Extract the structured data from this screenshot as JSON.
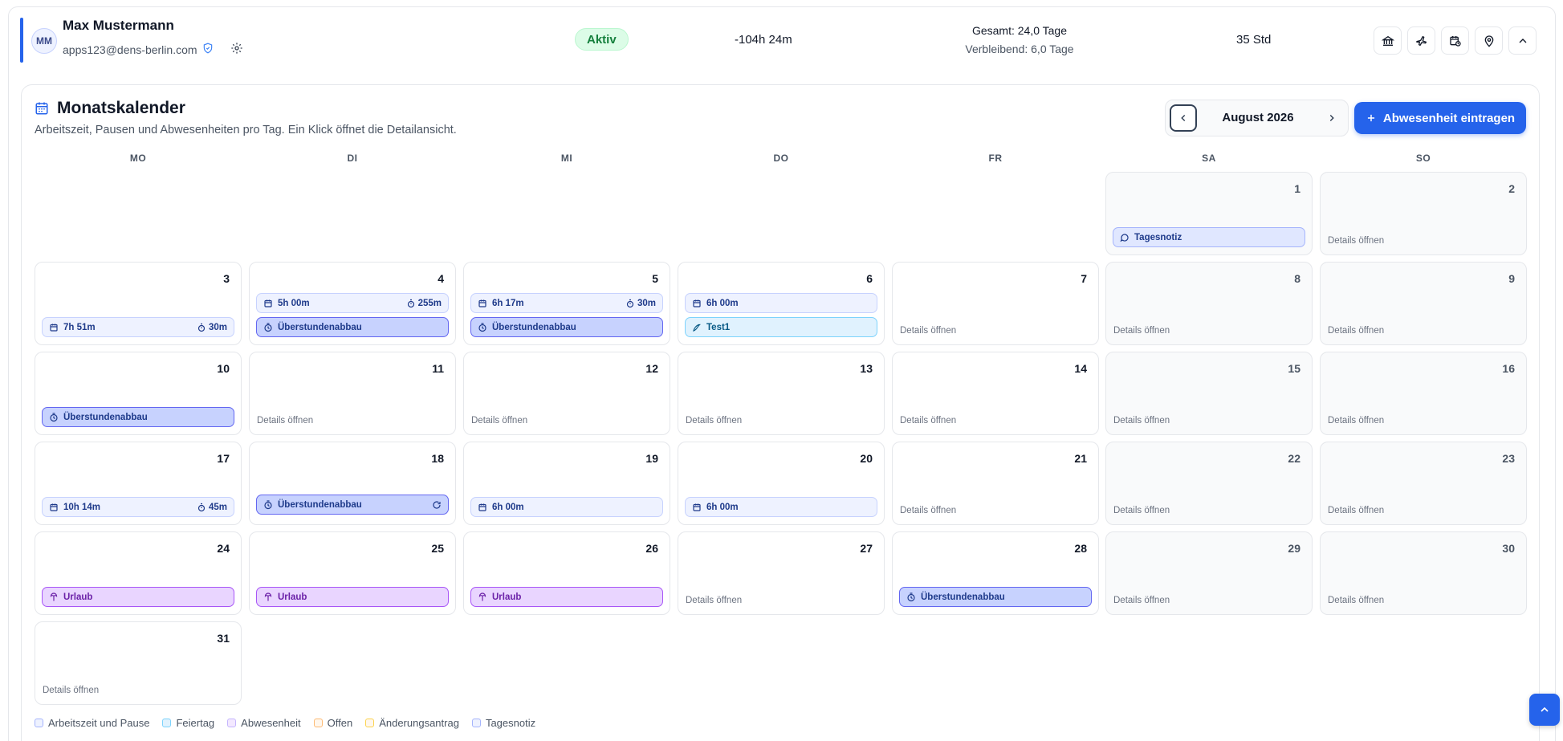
{
  "user": {
    "initials": "MM",
    "name": "Max Mustermann",
    "email": "apps123@dens-berlin.com",
    "status": "Aktiv",
    "balance": "-104h 24m",
    "vacation_total": "Gesamt: 24,0 Tage",
    "vacation_remaining": "Verbleibend: 6,0 Tage",
    "weekly_hours": "35 Std"
  },
  "header_actions": [
    "bank-icon",
    "plane-icon",
    "calendar-clock-icon",
    "map-pin-icon",
    "chevron-up-icon"
  ],
  "calendar": {
    "title": "Monatskalender",
    "subtitle": "Arbeitszeit, Pausen und Abwesenheiten pro Tag. Ein Klick öffnet die Detailansicht.",
    "month_label": "August 2026",
    "add_button": "Abwesenheit eintragen",
    "weekdays": [
      "MO",
      "DI",
      "MI",
      "DO",
      "FR",
      "SA",
      "SO"
    ],
    "details_label": "Details öffnen",
    "days": {
      "1": {
        "chips": [
          {
            "type": "note",
            "label": "Tagesnotiz"
          }
        ]
      },
      "2": {
        "details": true
      },
      "3": {
        "chips": [
          {
            "type": "work",
            "label": "7h 51m",
            "pause": "30m"
          }
        ]
      },
      "4": {
        "chips": [
          {
            "type": "work",
            "label": "5h 00m",
            "pause": "255m"
          },
          {
            "type": "comp",
            "label": "Überstundenabbau"
          }
        ]
      },
      "5": {
        "chips": [
          {
            "type": "work",
            "label": "6h 17m",
            "pause": "30m"
          },
          {
            "type": "comp",
            "label": "Überstundenabbau"
          }
        ]
      },
      "6": {
        "chips": [
          {
            "type": "work",
            "label": "6h 00m"
          },
          {
            "type": "other",
            "label": "Test1"
          }
        ]
      },
      "7": {
        "details": true
      },
      "8": {
        "details": true
      },
      "9": {
        "details": true
      },
      "10": {
        "chips": [
          {
            "type": "comp",
            "label": "Überstundenabbau"
          }
        ]
      },
      "11": {
        "details": true
      },
      "12": {
        "details": true
      },
      "13": {
        "details": true
      },
      "14": {
        "details": true
      },
      "15": {
        "details": true
      },
      "16": {
        "details": true
      },
      "17": {
        "chips": [
          {
            "type": "work",
            "label": "10h 14m",
            "pause": "45m"
          }
        ]
      },
      "18": {
        "chips": [
          {
            "type": "comp",
            "label": "Überstundenabbau",
            "recurring": true
          }
        ]
      },
      "19": {
        "chips": [
          {
            "type": "work",
            "label": "6h 00m"
          }
        ]
      },
      "20": {
        "chips": [
          {
            "type": "work",
            "label": "6h 00m"
          }
        ]
      },
      "21": {
        "details": true
      },
      "22": {
        "details": true
      },
      "23": {
        "details": true
      },
      "24": {
        "chips": [
          {
            "type": "vac",
            "label": "Urlaub"
          }
        ]
      },
      "25": {
        "chips": [
          {
            "type": "vac",
            "label": "Urlaub"
          }
        ]
      },
      "26": {
        "chips": [
          {
            "type": "vac",
            "label": "Urlaub"
          }
        ]
      },
      "27": {
        "details": true
      },
      "28": {
        "chips": [
          {
            "type": "comp",
            "label": "Überstundenabbau"
          }
        ]
      },
      "29": {
        "details": true
      },
      "30": {
        "details": true
      },
      "31": {
        "details": true
      }
    }
  },
  "legend": [
    {
      "label": "Arbeitszeit und Pause",
      "color": "#eef2ff",
      "border": "#a5b4fc"
    },
    {
      "label": "Feiertag",
      "color": "#e0f2fe",
      "border": "#7dd3fc"
    },
    {
      "label": "Abwesenheit",
      "color": "#f3e8ff",
      "border": "#c4b5fd"
    },
    {
      "label": "Offen",
      "color": "#fff7ed",
      "border": "#fdba74"
    },
    {
      "label": "Änderungsantrag",
      "color": "#fff7ed",
      "border": "#fcd34d"
    },
    {
      "label": "Tagesnotiz",
      "color": "#eef2ff",
      "border": "#a5b4fc"
    }
  ],
  "colors": {
    "accent": "#2563eb",
    "status_green": "#15803d"
  }
}
